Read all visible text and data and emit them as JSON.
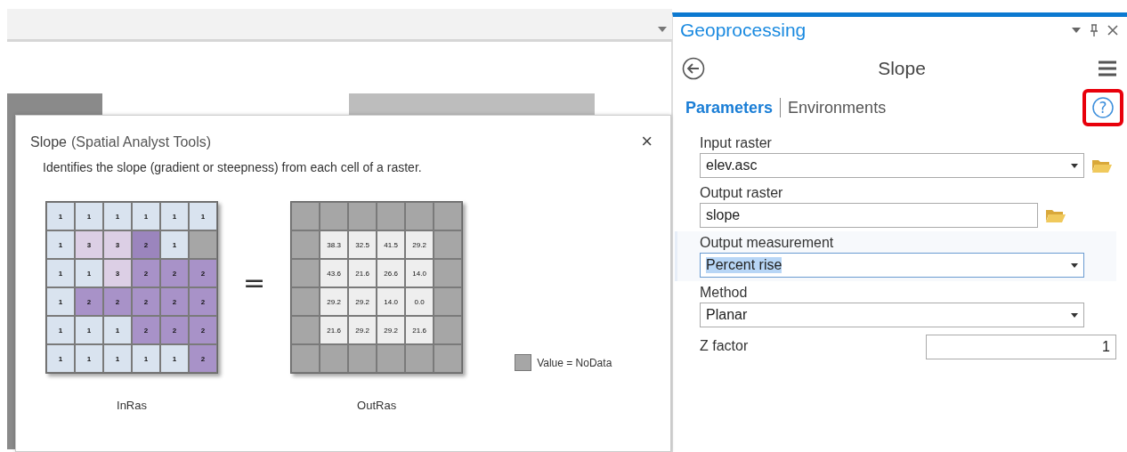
{
  "popup": {
    "title": "Slope",
    "subtitle": "(Spatial Analyst Tools)",
    "close": "×",
    "description": "Identifies the slope (gradient or steepness) from each cell of a raster.",
    "inras": {
      "caption": "InRas",
      "rows": [
        [
          {
            "text": "1",
            "color": "#d9e3ef"
          },
          {
            "text": "1",
            "color": "#d9e3ef"
          },
          {
            "text": "1",
            "color": "#d9e3ef"
          },
          {
            "text": "1",
            "color": "#d9e3ef"
          },
          {
            "text": "1",
            "color": "#d9e3ef"
          },
          {
            "text": "1",
            "color": "#d9e3ef"
          }
        ],
        [
          {
            "text": "1",
            "color": "#d9e3ef"
          },
          {
            "text": "3",
            "color": "#dccfe5"
          },
          {
            "text": "3",
            "color": "#dccfe5"
          },
          {
            "text": "2",
            "color": "#9b85bd"
          },
          {
            "text": "1",
            "color": "#d9e3ef"
          },
          {
            "color": "#a6a6a6"
          }
        ],
        [
          {
            "text": "1",
            "color": "#d9e3ef"
          },
          {
            "text": "1",
            "color": "#d9e3ef"
          },
          {
            "text": "3",
            "color": "#dccfe5"
          },
          {
            "text": "2",
            "color": "#a892c8"
          },
          {
            "text": "2",
            "color": "#a892c8"
          },
          {
            "text": "2",
            "color": "#a892c8"
          }
        ],
        [
          {
            "text": "1",
            "color": "#d9e3ef"
          },
          {
            "text": "2",
            "color": "#a892c8"
          },
          {
            "text": "2",
            "color": "#a892c8"
          },
          {
            "text": "2",
            "color": "#a892c8"
          },
          {
            "text": "2",
            "color": "#a892c8"
          },
          {
            "text": "2",
            "color": "#a892c8"
          }
        ],
        [
          {
            "text": "1",
            "color": "#d9e3ef"
          },
          {
            "text": "1",
            "color": "#d9e3ef"
          },
          {
            "text": "1",
            "color": "#d9e3ef"
          },
          {
            "text": "2",
            "color": "#a892c8"
          },
          {
            "text": "2",
            "color": "#a892c8"
          },
          {
            "text": "2",
            "color": "#a892c8"
          }
        ],
        [
          {
            "text": "1",
            "color": "#d9e3ef"
          },
          {
            "text": "1",
            "color": "#d9e3ef"
          },
          {
            "text": "1",
            "color": "#d9e3ef"
          },
          {
            "text": "1",
            "color": "#d9e3ef"
          },
          {
            "text": "1",
            "color": "#d9e3ef"
          },
          {
            "text": "2",
            "color": "#a892c8"
          }
        ]
      ]
    },
    "equals": "=",
    "outras": {
      "caption": "OutRas",
      "rows": [
        [
          {
            "color": "#a6a6a6"
          },
          {
            "color": "#a6a6a6"
          },
          {
            "color": "#a6a6a6"
          },
          {
            "color": "#a6a6a6"
          },
          {
            "color": "#a6a6a6"
          },
          {
            "color": "#a6a6a6"
          }
        ],
        [
          {
            "color": "#a6a6a6"
          },
          {
            "text": "38.3",
            "color": "#eeeeee"
          },
          {
            "text": "32.5",
            "color": "#eeeeee"
          },
          {
            "text": "41.5",
            "color": "#eeeeee"
          },
          {
            "text": "29.2",
            "color": "#eeeeee"
          },
          {
            "color": "#a6a6a6"
          }
        ],
        [
          {
            "color": "#a6a6a6"
          },
          {
            "text": "43.6",
            "color": "#eeeeee"
          },
          {
            "text": "21.6",
            "color": "#eeeeee"
          },
          {
            "text": "26.6",
            "color": "#eeeeee"
          },
          {
            "text": "14.0",
            "color": "#eeeeee"
          },
          {
            "color": "#a6a6a6"
          }
        ],
        [
          {
            "color": "#a6a6a6"
          },
          {
            "text": "29.2",
            "color": "#eeeeee"
          },
          {
            "text": "29.2",
            "color": "#eeeeee"
          },
          {
            "text": "14.0",
            "color": "#eeeeee"
          },
          {
            "text": "0.0",
            "color": "#eeeeee"
          },
          {
            "color": "#a6a6a6"
          }
        ],
        [
          {
            "color": "#a6a6a6"
          },
          {
            "text": "21.6",
            "color": "#eeeeee"
          },
          {
            "text": "29.2",
            "color": "#eeeeee"
          },
          {
            "text": "29.2",
            "color": "#eeeeee"
          },
          {
            "text": "21.6",
            "color": "#eeeeee"
          },
          {
            "color": "#a6a6a6"
          }
        ],
        [
          {
            "color": "#a6a6a6"
          },
          {
            "color": "#a6a6a6"
          },
          {
            "color": "#a6a6a6"
          },
          {
            "color": "#a6a6a6"
          },
          {
            "color": "#a6a6a6"
          },
          {
            "color": "#a6a6a6"
          }
        ]
      ]
    },
    "legend": {
      "label": "Value = NoData",
      "color": "#a6a6a6"
    }
  },
  "panel": {
    "title": "Geoprocessing",
    "tool": "Slope",
    "tabs": [
      {
        "label": "Parameters",
        "selected": true
      },
      {
        "label": "Environments",
        "selected": false
      }
    ],
    "help_highlighted": true,
    "help_glyph": "?",
    "params": [
      {
        "label": "Input raster",
        "kind": "dropdown",
        "value": "elev.asc",
        "browse": true,
        "active": false,
        "value_selected": false
      },
      {
        "label": "Output raster",
        "kind": "text",
        "value": "slope",
        "browse": true,
        "active": false,
        "value_selected": false
      },
      {
        "label": "Output measurement",
        "kind": "dropdown",
        "value": "Percent rise",
        "browse": false,
        "active": true,
        "value_selected": true
      },
      {
        "label": "Method",
        "kind": "dropdown",
        "value": "Planar",
        "browse": false,
        "active": false,
        "value_selected": false
      },
      {
        "label": "Z factor",
        "kind": "number",
        "value": "1",
        "browse": false,
        "active": false,
        "value_selected": false
      }
    ]
  }
}
